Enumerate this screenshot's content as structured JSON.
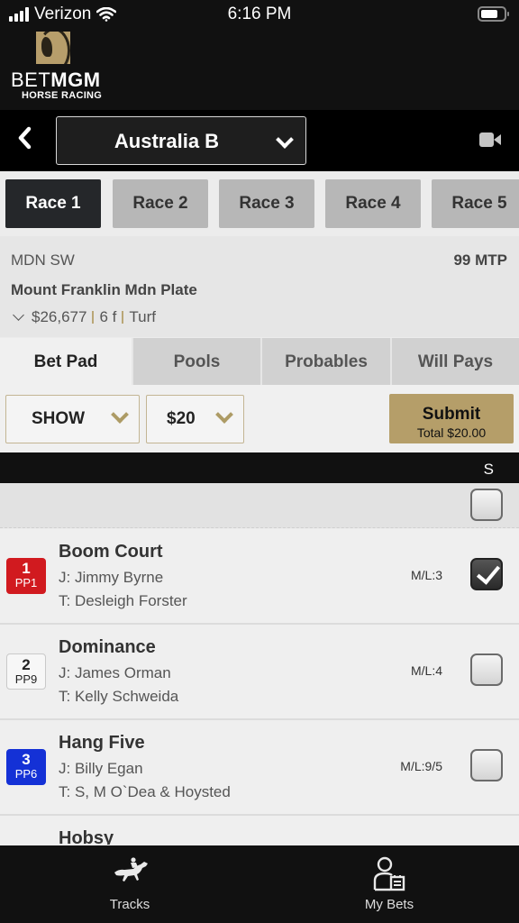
{
  "status_bar": {
    "carrier": "Verizon",
    "time": "6:16 PM",
    "icons": [
      "signal-icon",
      "wifi-icon",
      "battery-icon"
    ]
  },
  "header": {
    "brand_light": "BET",
    "brand_bold": "MGM",
    "subtitle": "HORSE RACING"
  },
  "track_bar": {
    "back_icon": "chevron-left-icon",
    "selected_track": "Australia B",
    "video_icon": "video-camera-icon"
  },
  "race_tabs": [
    {
      "label": "Race 1",
      "active": true
    },
    {
      "label": "Race 2",
      "active": false
    },
    {
      "label": "Race 3",
      "active": false
    },
    {
      "label": "Race 4",
      "active": false
    },
    {
      "label": "Race 5",
      "active": false
    }
  ],
  "race_info": {
    "race_class": "MDN SW",
    "mtp": "99 MTP",
    "race_name": "Mount Franklin Mdn Plate",
    "purse": "$26,677",
    "distance": "6 f",
    "surface": "Turf"
  },
  "bet_tabs": [
    {
      "label": "Bet Pad",
      "active": true
    },
    {
      "label": "Pools",
      "active": false
    },
    {
      "label": "Probables",
      "active": false
    },
    {
      "label": "Will Pays",
      "active": false
    }
  ],
  "bet_controls": {
    "bet_type": "SHOW",
    "amount": "$20",
    "submit_label": "Submit",
    "total_label": "Total $20.00"
  },
  "column_header": {
    "show_label": "S"
  },
  "select_all_checked": false,
  "runners": [
    {
      "number": "1",
      "pp": "PP1",
      "color": "red",
      "name": "Boom Court",
      "jockey": "J: Jimmy Byrne",
      "trainer": "T: Desleigh Forster",
      "ml": "M/L:3",
      "checked": true
    },
    {
      "number": "2",
      "pp": "PP9",
      "color": "white",
      "name": "Dominance",
      "jockey": "J: James Orman",
      "trainer": "T: Kelly Schweida",
      "ml": "M/L:4",
      "checked": false
    },
    {
      "number": "3",
      "pp": "PP6",
      "color": "blue",
      "name": "Hang Five",
      "jockey": "J: Billy Egan",
      "trainer": "T: S, M O`Dea & Hoysted",
      "ml": "M/L:9/5",
      "checked": false
    },
    {
      "number": "",
      "pp": "",
      "color": "yellow",
      "name": "Hobsy",
      "jockey": "",
      "trainer": "",
      "ml": "",
      "checked": false
    }
  ],
  "bottom_nav": [
    {
      "label": "Tracks",
      "icon": "horse-racing-icon"
    },
    {
      "label": "My Bets",
      "icon": "my-bets-icon"
    }
  ],
  "colors": {
    "gold_accent": "#b59e69",
    "dark_bg": "#111111",
    "active_tab": "#25272a",
    "inactive_tab": "#b7b7b7",
    "pp1_red": "#d11a1f",
    "pp3_blue": "#1431d6"
  }
}
